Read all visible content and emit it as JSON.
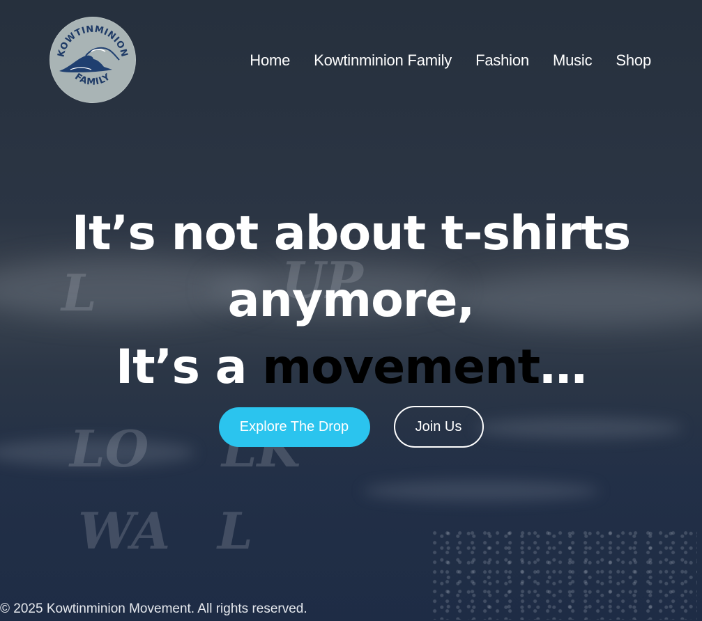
{
  "header": {
    "logo": {
      "top_text": "KOWTINMINION",
      "bottom_text": "FAMILY",
      "icon": "wave-icon"
    },
    "nav": [
      {
        "label": "Home"
      },
      {
        "label": "Kowtinminion Family"
      },
      {
        "label": "Fashion"
      },
      {
        "label": "Music"
      },
      {
        "label": "Shop"
      }
    ]
  },
  "hero": {
    "line1": "It’s not about t-shirts",
    "line2": "anymore,",
    "line3_prefix": "It’s a ",
    "line3_highlight": "movement",
    "line3_suffix": "…"
  },
  "cta": {
    "primary": "Explore The Drop",
    "secondary": "Join Us"
  },
  "footer": {
    "copyright": "© 2025 Kowtinminion Movement. All rights reserved."
  },
  "colors": {
    "accent": "#2bc4ee",
    "background": "#283241",
    "text": "#ffffff",
    "highlight": "#000000"
  }
}
